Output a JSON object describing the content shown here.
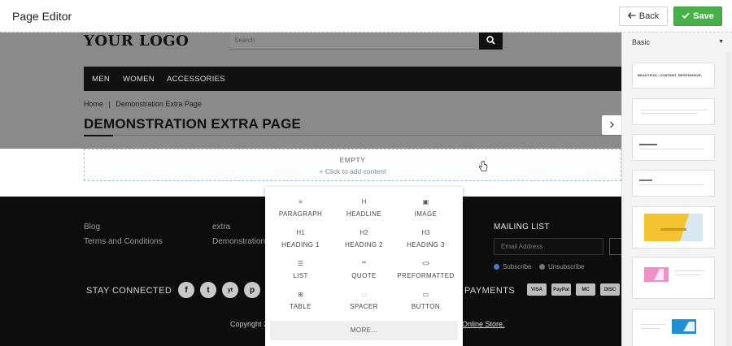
{
  "header": {
    "title": "Page Editor",
    "back_label": "Back",
    "save_label": "Save"
  },
  "site": {
    "logo": "YOUR LOGO",
    "search_placeholder": "Search",
    "nav": [
      "MEN",
      "WOMEN",
      "ACCESSORIES"
    ],
    "breadcrumb": {
      "home": "Home",
      "sep": "|",
      "current": "Demonstration Extra Page"
    },
    "page_title": "DEMONSTRATION EXTRA PAGE"
  },
  "empty_block": {
    "title": "EMPTY",
    "hint": "+ Click to add content"
  },
  "footer": {
    "col1": [
      "Blog",
      "Terms and Conditions"
    ],
    "col2": [
      "extra",
      "Demonstration"
    ],
    "mailing_title": "MAILING LIST",
    "email_placeholder": "Email Address",
    "subscribe": "Subscribe",
    "unsubscribe": "Unsubscribe",
    "stay_connected": "STAY CONNECTED",
    "social": [
      "f",
      "t",
      "yt",
      "p"
    ],
    "payments_title": "PAYMENTS",
    "cards": [
      "VISA",
      "PayPal",
      "MC",
      "DISC"
    ],
    "copyright_prefix": "Copyright 2",
    "copyright_link": "Online Store",
    "copyright_suffix": "."
  },
  "content_picker": {
    "items": [
      {
        "label": "PARAGRAPH",
        "icon": "≡"
      },
      {
        "label": "HEADLINE",
        "icon": "H"
      },
      {
        "label": "IMAGE",
        "icon": "▣"
      },
      {
        "label": "HEADING 1",
        "icon": "H1"
      },
      {
        "label": "HEADING 2",
        "icon": "H2"
      },
      {
        "label": "HEADING 3",
        "icon": "H3"
      },
      {
        "label": "LIST",
        "icon": "☰"
      },
      {
        "label": "QUOTE",
        "icon": "❛❛"
      },
      {
        "label": "PREFORMATTED",
        "icon": "<>"
      },
      {
        "label": "TABLE",
        "icon": "⊞"
      },
      {
        "label": "SPACER",
        "icon": "▭"
      },
      {
        "label": "BUTTON",
        "icon": "▭"
      }
    ],
    "more_label": "MORE..."
  },
  "side_panel": {
    "dropdown_value": "Basic",
    "thumb1_text": "BEAUTIFUL. CONTENT. RESPONSIVE."
  },
  "colors": {
    "save": "#47b04b",
    "overlay": "#8a8a8a",
    "footer": "#0d0d0d",
    "subscribe_dot": "#3f7ad6"
  }
}
